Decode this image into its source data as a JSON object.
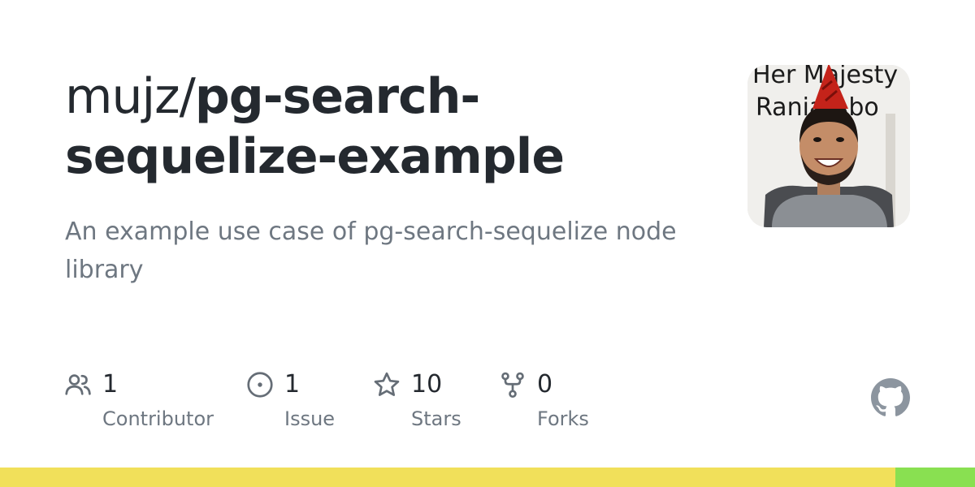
{
  "repo": {
    "owner": "mujz/",
    "name": "pg-search-sequelize-example",
    "description": "An example use case of pg-search-sequelize node library"
  },
  "avatar": {
    "sign_text_line1": "Her Majesty",
    "sign_text_line2": "Rania Abo"
  },
  "stats": [
    {
      "icon": "people-icon",
      "count": "1",
      "label": "Contributor"
    },
    {
      "icon": "issue-icon",
      "count": "1",
      "label": "Issue"
    },
    {
      "icon": "star-icon",
      "count": "10",
      "label": "Stars"
    },
    {
      "icon": "fork-icon",
      "count": "0",
      "label": "Forks"
    }
  ],
  "languages": [
    {
      "fraction": 0.918,
      "color": "#f1e05a"
    },
    {
      "fraction": 0.082,
      "color": "#89e051"
    }
  ],
  "colors": {
    "title": "#24292f",
    "muted": "#6e7781",
    "icon": "#656d76",
    "github_logo": "#8c959f"
  }
}
